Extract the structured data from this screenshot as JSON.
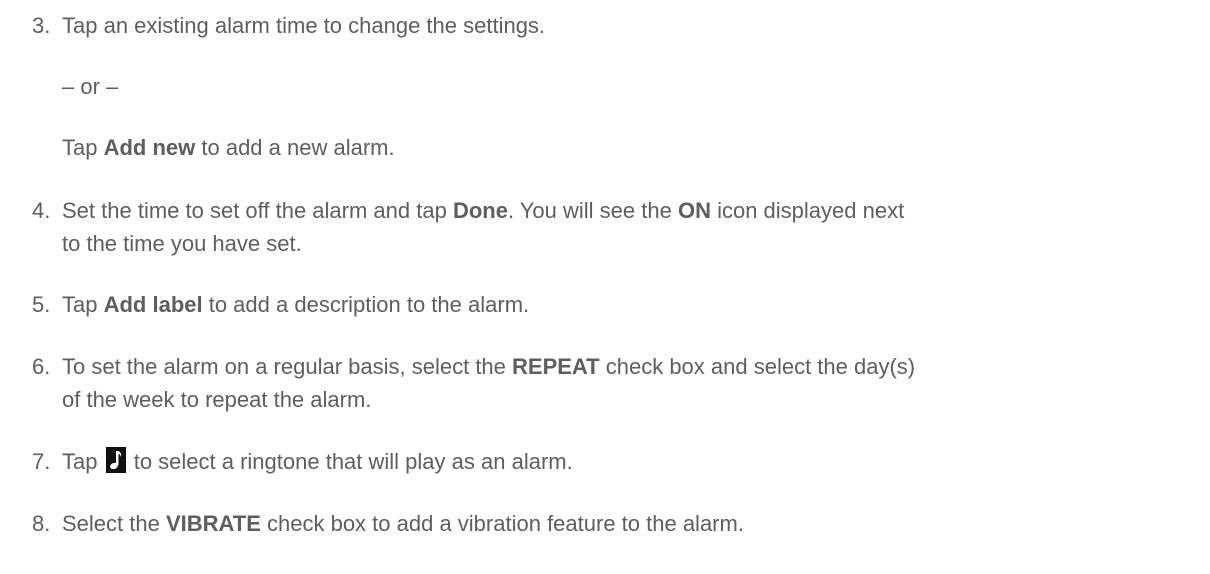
{
  "steps": [
    {
      "num": "3.",
      "pre": "Tap an existing alarm time to change the settings."
    },
    {
      "or": "– or –"
    },
    {
      "pre": "Tap ",
      "b1": "Add new",
      "post": " to add a new alarm."
    },
    {
      "num": "4.",
      "pre": "Set the time to set off the alarm and tap ",
      "b1": "Done",
      "mid": ". You will see the ",
      "b2": "ON",
      "post": " icon displayed next",
      "line2": "to the time you have set."
    },
    {
      "num": "5.",
      "pre": "Tap ",
      "b1": "Add label",
      "post": " to add a description to the alarm."
    },
    {
      "num": "6.",
      "pre": "To set the alarm on a regular basis, select the ",
      "b1": "REPEAT",
      "post": " check box and select the day(s)",
      "line2": "of the week to repeat the alarm."
    },
    {
      "num": "7.",
      "pre": "Tap ",
      "post": " to select a ringtone that will play as an alarm.",
      "icon": "music-note-icon"
    },
    {
      "num": "8.",
      "pre": "Select the ",
      "b1": "VIBRATE",
      "post": " check box to add a vibration feature to the alarm."
    }
  ]
}
